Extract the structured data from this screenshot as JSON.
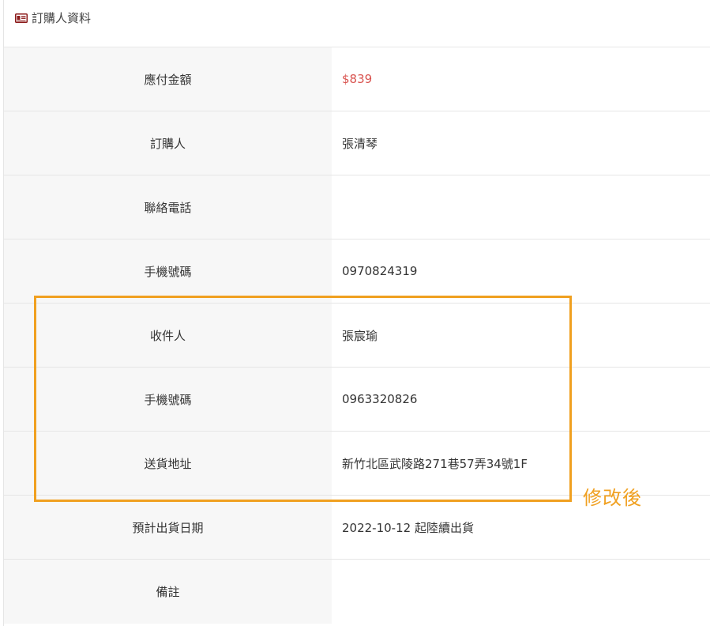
{
  "panel": {
    "title": "訂購人資料",
    "icon": "id-card-icon",
    "accent_color": "#8b1a1a"
  },
  "rows": [
    {
      "label": "應付金額",
      "value": "$839"
    },
    {
      "label": "訂購人",
      "value": "張清琴"
    },
    {
      "label": "聯絡電話",
      "value": ""
    },
    {
      "label": "手機號碼",
      "value": "0970824319"
    },
    {
      "label": "收件人",
      "value": "張宸瑜"
    },
    {
      "label": "手機號碼",
      "value": "0963320826"
    },
    {
      "label": "送貨地址",
      "value": "新竹北區武陵路271巷57弄34號1F"
    },
    {
      "label": "預計出貨日期",
      "value": "2022-10-12 起陸續出貨"
    },
    {
      "label": "備註",
      "value": ""
    }
  ],
  "annotation": {
    "note": "修改後",
    "color": "#f0a020"
  },
  "colors": {
    "price": "#d9534f",
    "label_bg": "#f7f7f7"
  }
}
